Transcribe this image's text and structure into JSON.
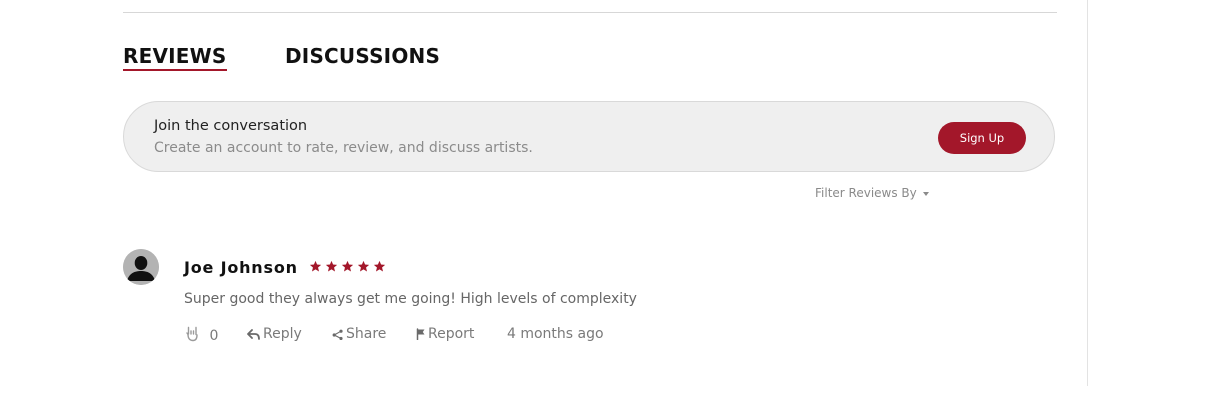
{
  "tabs": {
    "reviews_label": "REVIEWS",
    "discussions_label": "DISCUSSIONS"
  },
  "banner": {
    "title": "Join the conversation",
    "subtitle": "Create an account to rate, review, and discuss artists.",
    "signup_label": "Sign Up"
  },
  "filter": {
    "label": "Filter Reviews By"
  },
  "review": {
    "name": "Joe Johnson",
    "rating": 5,
    "rating_max": 5,
    "text": "Super good they always get me going! High levels of complexity",
    "likes": "0",
    "reply_label": "Reply",
    "share_label": "Share",
    "report_label": "Report",
    "time": "4 months ago"
  },
  "colors": {
    "accent": "#a3172a",
    "banner_bg": "#efefef",
    "muted_text": "#8a8a8a"
  },
  "icons": {
    "like": "rock-hand-icon",
    "reply": "reply-arrow-icon",
    "share": "share-icon",
    "report": "flag-icon",
    "avatar": "user-silhouette-icon",
    "filter": "caret-down-icon"
  }
}
